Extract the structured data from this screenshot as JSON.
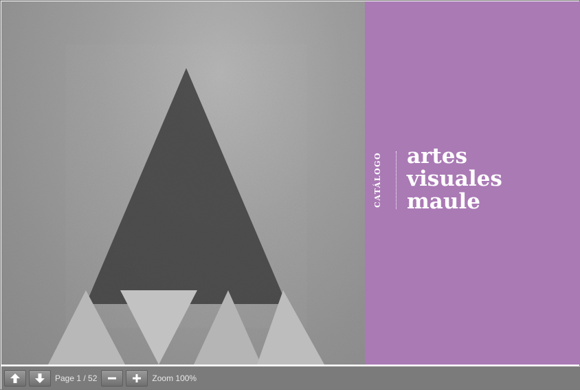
{
  "toolbar": {
    "prev_page_icon": "arrow-up-icon",
    "next_page_icon": "arrow-down-icon",
    "page_text": "Page 1 / 52",
    "zoom_out_icon": "minus-icon",
    "zoom_in_icon": "plus-icon",
    "zoom_text": "Zoom 100%"
  },
  "cover": {
    "vertical_label": "CATÁLOGO",
    "title_lines": [
      "artes",
      "visuales",
      "maule"
    ],
    "panel_color": "#aa7ab5"
  },
  "colors": {
    "toolbar_bg": "#7b7b7b",
    "toolbar_text": "#e8e8e8",
    "cover_text": "#ffffff"
  }
}
